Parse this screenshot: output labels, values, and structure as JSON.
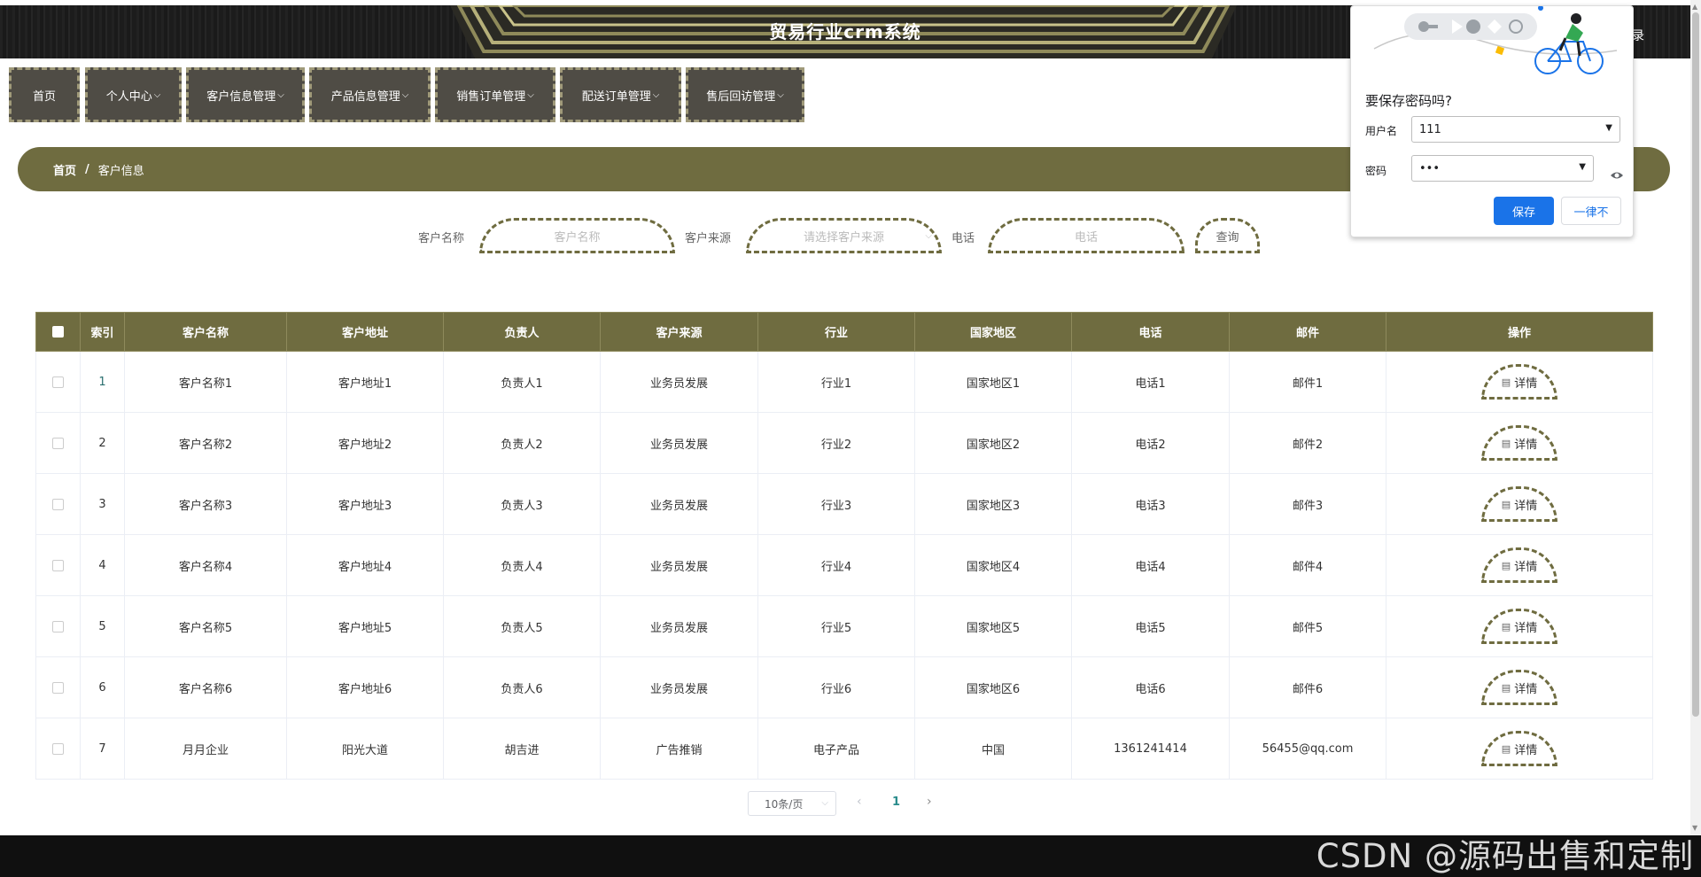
{
  "header": {
    "title": "贸易行业crm系统",
    "right_text": "录"
  },
  "nav": {
    "items": [
      {
        "label": "首页",
        "has_menu": false
      },
      {
        "label": "个人中心",
        "has_menu": true
      },
      {
        "label": "客户信息管理",
        "has_menu": true
      },
      {
        "label": "产品信息管理",
        "has_menu": true
      },
      {
        "label": "销售订单管理",
        "has_menu": true
      },
      {
        "label": "配送订单管理",
        "has_menu": true
      },
      {
        "label": "售后回访管理",
        "has_menu": true
      }
    ],
    "chevron": "⌵"
  },
  "breadcrumb": {
    "home": "首页",
    "separator": "/",
    "current": "客户信息"
  },
  "search": {
    "name_label": "客户名称",
    "name_placeholder": "客户名称",
    "source_label": "客户来源",
    "source_placeholder": "请选择客户来源",
    "phone_label": "电话",
    "phone_placeholder": "电话",
    "query_button": "查询"
  },
  "table": {
    "headers": [
      "索引",
      "客户名称",
      "客户地址",
      "负责人",
      "客户来源",
      "行业",
      "国家地区",
      "电话",
      "邮件",
      "操作"
    ],
    "action_label": "详情",
    "rows": [
      {
        "index": "1",
        "name": "客户名称1",
        "address": "客户地址1",
        "owner": "负责人1",
        "source": "业务员发展",
        "industry": "行业1",
        "region": "国家地区1",
        "phone": "电话1",
        "email": "邮件1"
      },
      {
        "index": "2",
        "name": "客户名称2",
        "address": "客户地址2",
        "owner": "负责人2",
        "source": "业务员发展",
        "industry": "行业2",
        "region": "国家地区2",
        "phone": "电话2",
        "email": "邮件2"
      },
      {
        "index": "3",
        "name": "客户名称3",
        "address": "客户地址3",
        "owner": "负责人3",
        "source": "业务员发展",
        "industry": "行业3",
        "region": "国家地区3",
        "phone": "电话3",
        "email": "邮件3"
      },
      {
        "index": "4",
        "name": "客户名称4",
        "address": "客户地址4",
        "owner": "负责人4",
        "source": "业务员发展",
        "industry": "行业4",
        "region": "国家地区4",
        "phone": "电话4",
        "email": "邮件4"
      },
      {
        "index": "5",
        "name": "客户名称5",
        "address": "客户地址5",
        "owner": "负责人5",
        "source": "业务员发展",
        "industry": "行业5",
        "region": "国家地区5",
        "phone": "电话5",
        "email": "邮件5"
      },
      {
        "index": "6",
        "name": "客户名称6",
        "address": "客户地址6",
        "owner": "负责人6",
        "source": "业务员发展",
        "industry": "行业6",
        "region": "国家地区6",
        "phone": "电话6",
        "email": "邮件6"
      },
      {
        "index": "7",
        "name": "月月企业",
        "address": "阳光大道",
        "owner": "胡吉进",
        "source": "广告推销",
        "industry": "电子产品",
        "region": "中国",
        "phone": "1361241414",
        "email": "56455@qq.com"
      }
    ]
  },
  "pagination": {
    "page_size": "10条/页",
    "current_page": "1",
    "prev": "‹",
    "next": "›"
  },
  "password_popup": {
    "title": "要保存密码吗?",
    "username_label": "用户名",
    "username_value": "111",
    "password_label": "密码",
    "password_value": "•••",
    "save_button": "保存",
    "never_button": "一律不"
  },
  "watermark": "CSDN @源码出售和定制",
  "colors": {
    "primary": "#6f6c40",
    "header_bg": "#1a1a1a",
    "nav_bg": "#4f4c45",
    "popup_blue": "#1a73e8"
  }
}
